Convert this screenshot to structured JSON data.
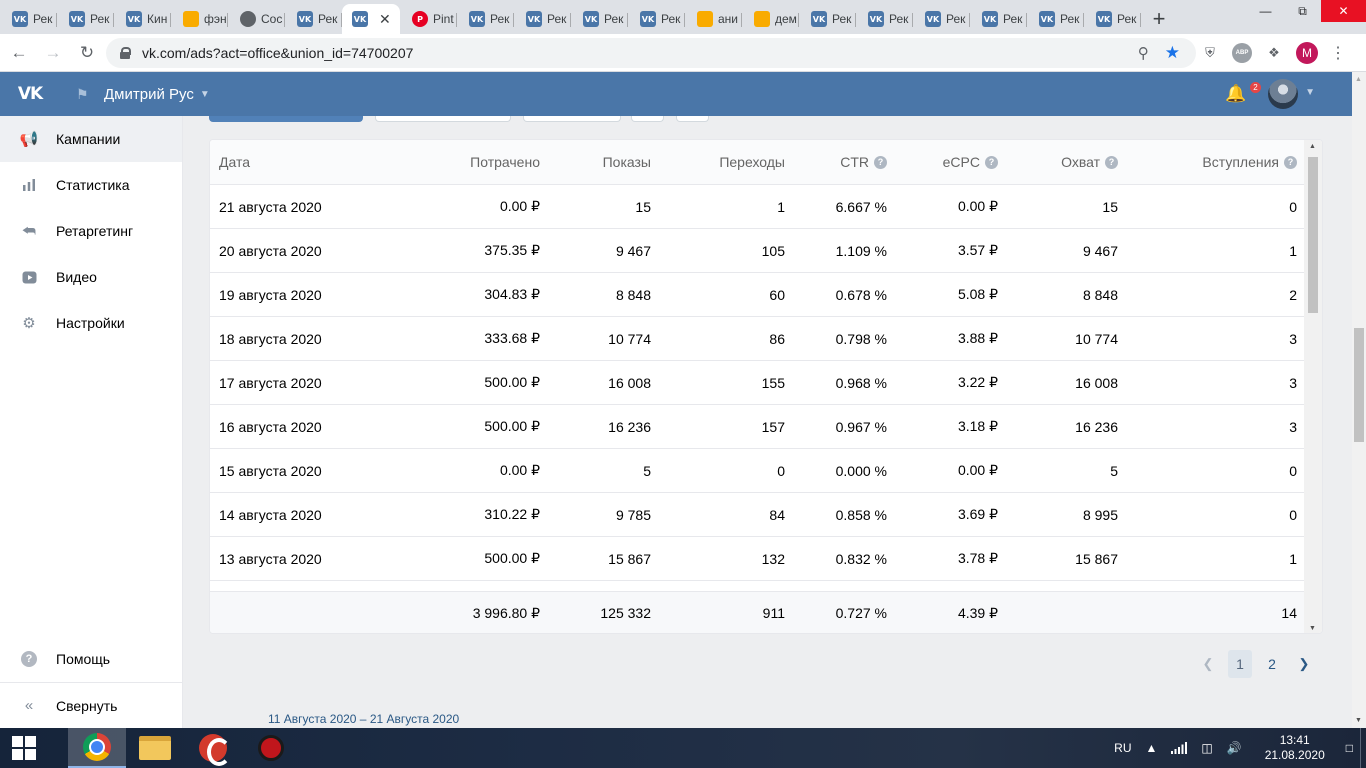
{
  "browser": {
    "tabs": [
      {
        "label": "Рек",
        "favicon": "vk"
      },
      {
        "label": "Рек",
        "favicon": "vk"
      },
      {
        "label": "Кин",
        "favicon": "vk"
      },
      {
        "label": "фэн",
        "favicon": "img"
      },
      {
        "label": "Сос",
        "favicon": "chat"
      },
      {
        "label": "Рек",
        "favicon": "vk"
      },
      {
        "label": "",
        "favicon": "vk",
        "active": true
      },
      {
        "label": "Pint",
        "favicon": "pin"
      },
      {
        "label": "Рек",
        "favicon": "vk"
      },
      {
        "label": "Рек",
        "favicon": "vk"
      },
      {
        "label": "Рек",
        "favicon": "vk"
      },
      {
        "label": "Рек",
        "favicon": "vk"
      },
      {
        "label": "ани",
        "favicon": "img"
      },
      {
        "label": "дем",
        "favicon": "img"
      },
      {
        "label": "Рек",
        "favicon": "vk"
      },
      {
        "label": "Рек",
        "favicon": "vk"
      },
      {
        "label": "Рек",
        "favicon": "vk"
      },
      {
        "label": "Рек",
        "favicon": "vk"
      },
      {
        "label": "Рек",
        "favicon": "vk"
      },
      {
        "label": "Рек",
        "favicon": "vk"
      }
    ],
    "url": "vk.com/ads?act=office&union_id=74700207",
    "profile_initial": "M",
    "extension_abp": "ABP"
  },
  "vk": {
    "logo": "VK",
    "account_name": "Дмитрий Рус",
    "notifications_count": "2"
  },
  "sidebar": {
    "items": [
      {
        "label": "Кампании",
        "icon": "megaphone-icon",
        "active": true
      },
      {
        "label": "Статистика",
        "icon": "bar-chart-icon"
      },
      {
        "label": "Ретаргетинг",
        "icon": "retarget-arrow-icon"
      },
      {
        "label": "Видео",
        "icon": "video-icon"
      },
      {
        "label": "Настройки",
        "icon": "gear-icon"
      }
    ],
    "help_label": "Помощь",
    "collapse_label": "Свернуть"
  },
  "table": {
    "headers": {
      "date": "Дата",
      "spent": "Потрачено",
      "impressions": "Показы",
      "clicks": "Переходы",
      "ctr": "CTR",
      "ecpc": "eCPC",
      "reach": "Охват",
      "joins": "Вступления"
    },
    "rows": [
      {
        "date": "21 августа 2020",
        "spent": "0.00 ₽",
        "impressions": "15",
        "clicks": "1",
        "ctr": "6.667 %",
        "ecpc": "0.00 ₽",
        "reach": "15",
        "joins": "0"
      },
      {
        "date": "20 августа 2020",
        "spent": "375.35 ₽",
        "impressions": "9 467",
        "clicks": "105",
        "ctr": "1.109 %",
        "ecpc": "3.57 ₽",
        "reach": "9 467",
        "joins": "1"
      },
      {
        "date": "19 августа 2020",
        "spent": "304.83 ₽",
        "impressions": "8 848",
        "clicks": "60",
        "ctr": "0.678 %",
        "ecpc": "5.08 ₽",
        "reach": "8 848",
        "joins": "2"
      },
      {
        "date": "18 августа 2020",
        "spent": "333.68 ₽",
        "impressions": "10 774",
        "clicks": "86",
        "ctr": "0.798 %",
        "ecpc": "3.88 ₽",
        "reach": "10 774",
        "joins": "3"
      },
      {
        "date": "17 августа 2020",
        "spent": "500.00 ₽",
        "impressions": "16 008",
        "clicks": "155",
        "ctr": "0.968 %",
        "ecpc": "3.22 ₽",
        "reach": "16 008",
        "joins": "3"
      },
      {
        "date": "16 августа 2020",
        "spent": "500.00 ₽",
        "impressions": "16 236",
        "clicks": "157",
        "ctr": "0.967 %",
        "ecpc": "3.18 ₽",
        "reach": "16 236",
        "joins": "3"
      },
      {
        "date": "15 августа 2020",
        "spent": "0.00 ₽",
        "impressions": "5",
        "clicks": "0",
        "ctr": "0.000 %",
        "ecpc": "0.00 ₽",
        "reach": "5",
        "joins": "0"
      },
      {
        "date": "14 августа 2020",
        "spent": "310.22 ₽",
        "impressions": "9 785",
        "clicks": "84",
        "ctr": "0.858 %",
        "ecpc": "3.69 ₽",
        "reach": "8 995",
        "joins": "0"
      },
      {
        "date": "13 августа 2020",
        "spent": "500.00 ₽",
        "impressions": "15 867",
        "clicks": "132",
        "ctr": "0.832 %",
        "ecpc": "3.78 ₽",
        "reach": "15 867",
        "joins": "1"
      }
    ],
    "total": {
      "date": "",
      "spent": "3 996.80 ₽",
      "impressions": "125 332",
      "clicks": "911",
      "ctr": "0.727 %",
      "ecpc": "4.39 ₽",
      "reach": "",
      "joins": "14"
    }
  },
  "pagination": {
    "pages": [
      "1",
      "2"
    ],
    "current": "1"
  },
  "date_range": "11 Августа 2020 – 21 Августа 2020",
  "taskbar": {
    "language": "RU",
    "time": "13:41",
    "date": "21.08.2020"
  },
  "colors": {
    "vk_blue": "#4a76a8",
    "link": "#2a5885",
    "accent": "#5181b8"
  }
}
